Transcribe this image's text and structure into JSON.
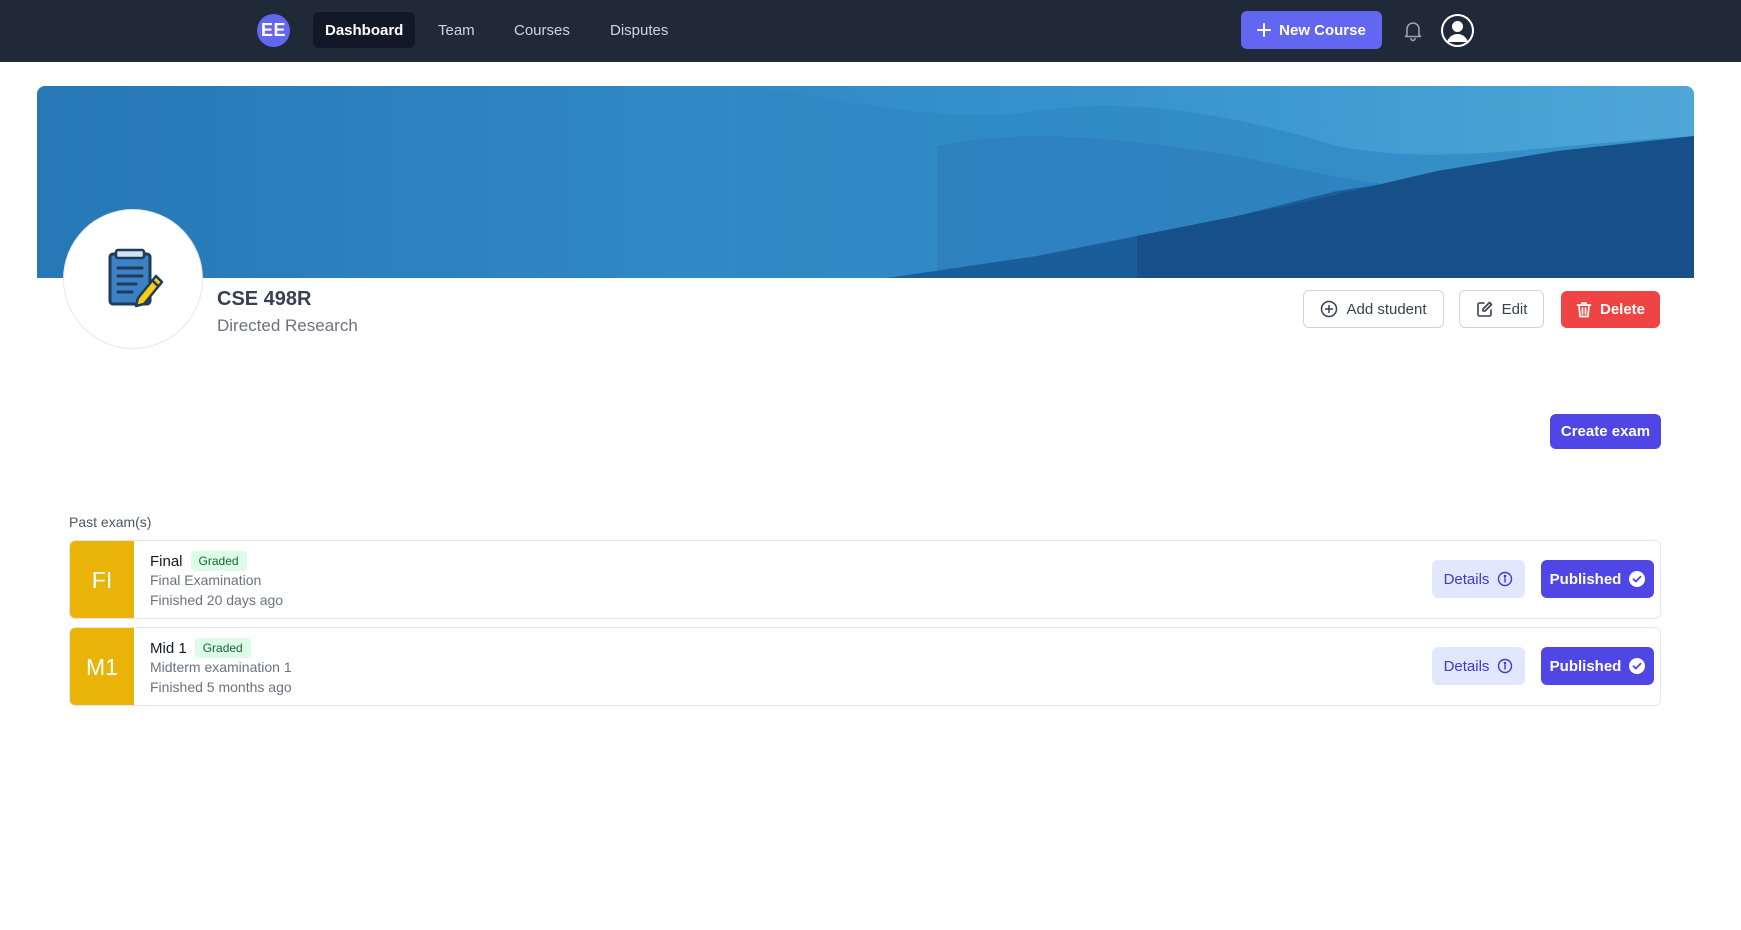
{
  "nav": {
    "logo_initials": "EE",
    "links": [
      {
        "label": "Dashboard",
        "active": true
      },
      {
        "label": "Team",
        "active": false
      },
      {
        "label": "Courses",
        "active": false
      },
      {
        "label": "Disputes",
        "active": false
      }
    ],
    "new_course_label": "New Course",
    "icons": {
      "add": "plus-icon",
      "notifications": "bell-icon",
      "avatar": "user-avatar"
    }
  },
  "course": {
    "code": "CSE 498R",
    "name": "Directed Research",
    "icon": "document-pencil-icon",
    "actions": {
      "add_student_label": "Add student",
      "edit_label": "Edit",
      "delete_label": "Delete"
    }
  },
  "create_exam_label": "Create exam",
  "past_exams": {
    "section_label": "Past exam(s)",
    "items": [
      {
        "initials": "FI",
        "title": "Final",
        "status": "Graded",
        "description": "Final Examination",
        "finished": "Finished 20 days ago",
        "details_label": "Details",
        "published_label": "Published"
      },
      {
        "initials": "M1",
        "title": "Mid 1",
        "status": "Graded",
        "description": "Midterm examination 1",
        "finished": "Finished 5 months ago",
        "details_label": "Details",
        "published_label": "Published"
      }
    ]
  },
  "colors": {
    "navbar": "#1f2937",
    "accent": "#4f46e5",
    "danger": "#ef4444",
    "exam_badge": "#eab308",
    "graded_bg": "#dcfce7"
  }
}
